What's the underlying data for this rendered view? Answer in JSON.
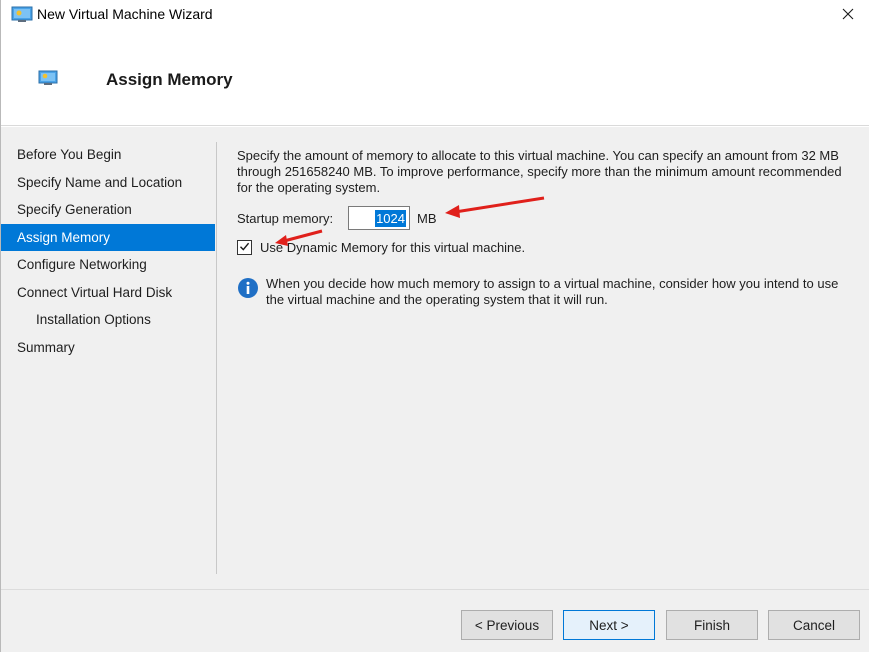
{
  "window": {
    "title": "New Virtual Machine Wizard"
  },
  "header": {
    "title": "Assign Memory"
  },
  "nav": {
    "items": [
      {
        "label": "Before You Begin"
      },
      {
        "label": "Specify Name and Location"
      },
      {
        "label": "Specify Generation"
      },
      {
        "label": "Assign Memory",
        "active": true
      },
      {
        "label": "Configure Networking"
      },
      {
        "label": "Connect Virtual Hard Disk"
      },
      {
        "label": "Installation Options",
        "sub": true
      },
      {
        "label": "Summary"
      }
    ]
  },
  "main": {
    "intro": "Specify the amount of memory to allocate to this virtual machine. You can specify an amount from 32 MB through 251658240 MB. To improve performance, specify more than the minimum amount recommended for the operating system.",
    "startup_memory_label": "Startup memory:",
    "startup_memory_value": "1024",
    "startup_memory_unit": "MB",
    "dynamic_memory_label": "Use Dynamic Memory for this virtual machine.",
    "dynamic_memory_checked": true,
    "info_text": "When you decide how much memory to assign to a virtual machine, consider how you intend to use the virtual machine and the operating system that it will run."
  },
  "buttons": {
    "previous": "< Previous",
    "next": "Next >",
    "finish": "Finish",
    "cancel": "Cancel"
  },
  "colors": {
    "accent": "#0078d7",
    "annotation_arrow": "#e0201b"
  },
  "icons": {
    "title": "virtual-machine-icon",
    "header": "virtual-machine-icon",
    "close": "close-icon",
    "info": "info-icon",
    "check": "checkmark-icon"
  }
}
